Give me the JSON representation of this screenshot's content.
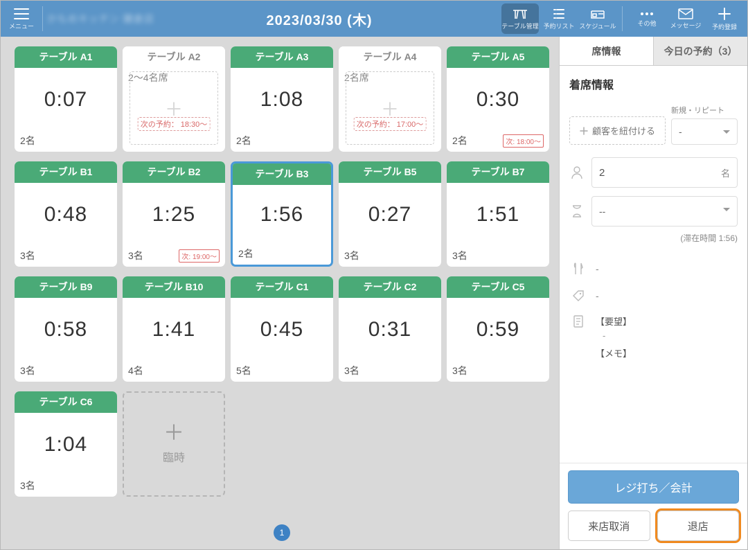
{
  "header": {
    "menu_label": "メニュー",
    "shop_name": "かもめキッチン 鎌倉店",
    "date_title": "2023/03/30 (木)",
    "tools": {
      "tables": "テーブル管理",
      "reservations": "予約リスト",
      "schedule": "スケジュール",
      "other": "その他",
      "messages": "メッセージ",
      "new": "予約登録"
    }
  },
  "floor": {
    "next_reserve_prefix": "次の予約：",
    "next_prefix": "次:",
    "temp_label": "臨時",
    "page": "1",
    "tables": [
      {
        "name": "テーブル A1",
        "time": "0:07",
        "foot": "2名"
      },
      {
        "name": "テーブル A2",
        "idle": true,
        "foot": "2〜4名席",
        "next_reserve": "18:30〜"
      },
      {
        "name": "テーブル A3",
        "time": "1:08",
        "foot": "2名"
      },
      {
        "name": "テーブル A4",
        "idle": true,
        "foot": "2名席",
        "next_reserve": "17:00〜"
      },
      {
        "name": "テーブル A5",
        "time": "0:30",
        "foot": "2名",
        "next": "18:00〜"
      },
      {
        "name": "テーブル B1",
        "time": "0:48",
        "foot": "3名"
      },
      {
        "name": "テーブル B2",
        "time": "1:25",
        "foot": "3名",
        "next": "19:00〜"
      },
      {
        "name": "テーブル B3",
        "time": "1:56",
        "foot": "2名",
        "selected": true
      },
      {
        "name": "テーブル B5",
        "time": "0:27",
        "foot": "3名"
      },
      {
        "name": "テーブル B7",
        "time": "1:51",
        "foot": "3名"
      },
      {
        "name": "テーブル B9",
        "time": "0:58",
        "foot": "3名"
      },
      {
        "name": "テーブル B10",
        "time": "1:41",
        "foot": "4名"
      },
      {
        "name": "テーブル C1",
        "time": "0:45",
        "foot": "5名"
      },
      {
        "name": "テーブル C2",
        "time": "0:31",
        "foot": "3名"
      },
      {
        "name": "テーブル C5",
        "time": "0:59",
        "foot": "3名"
      },
      {
        "name": "テーブル C6",
        "time": "1:04",
        "foot": "3名"
      }
    ]
  },
  "side": {
    "tabs": {
      "seat": "席情報",
      "today": "今日の予約（3）"
    },
    "heading": "着席情報",
    "link_customer": "顧客を紐付ける",
    "repeat_label": "新規・リピート",
    "repeat_value": "-",
    "guests_value": "2",
    "guests_suffix": "名",
    "duration_value": "--",
    "elapsed": "(滞在時間 1:56)",
    "course_value": "-",
    "tag_value": "-",
    "notes": {
      "request_label": "【要望】",
      "request_value": "-",
      "memo_label": "【メモ】"
    },
    "actions": {
      "register": "レジ打ち／会計",
      "cancel": "来店取消",
      "leave": "退店"
    }
  }
}
